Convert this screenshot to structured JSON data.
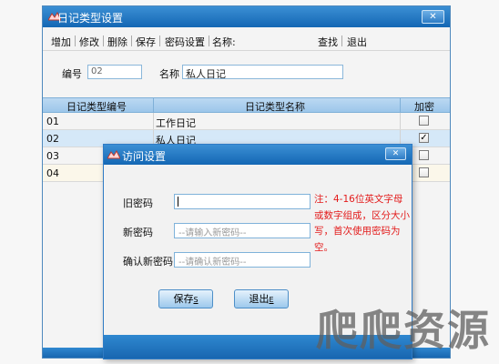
{
  "main_window": {
    "title": "日记类型设置",
    "close_label": "✕"
  },
  "toolbar": {
    "add": "增加",
    "edit": "修改",
    "delete": "删除",
    "save": "保存",
    "password_settings": "密码设置",
    "name_label": "名称:",
    "find": "查找",
    "exit": "退出"
  },
  "form": {
    "id_label": "编号",
    "id_value": "02",
    "name_label": "名称",
    "name_value": "私人日记"
  },
  "grid": {
    "columns": [
      "日记类型编号",
      "日记类型名称",
      "加密"
    ],
    "rows": [
      {
        "id": "01",
        "name": "工作日记",
        "encrypted": false
      },
      {
        "id": "02",
        "name": "私人日记",
        "encrypted": true
      },
      {
        "id": "03",
        "name": "",
        "encrypted": false
      },
      {
        "id": "04",
        "name": "",
        "encrypted": false
      }
    ]
  },
  "dialog": {
    "title": "访问设置",
    "close_label": "✕",
    "old_password_label": "旧密码",
    "new_password_label": "新密码",
    "new_password_placeholder": "--请输入新密码--",
    "confirm_password_label": "确认新密码",
    "confirm_password_placeholder": "--请确认新密码--",
    "note": "注：4-16位英文字母或数字组成，区分大小写，首次使用密码为空。",
    "save_button": "保存",
    "save_shortcut": "S",
    "exit_button": "退出",
    "exit_shortcut": "E"
  },
  "watermark": "爬爬资源",
  "colors": {
    "titlebar": "#1f78c8",
    "note_text": "#e31b1b",
    "selected_row": "#d5e8f8"
  }
}
